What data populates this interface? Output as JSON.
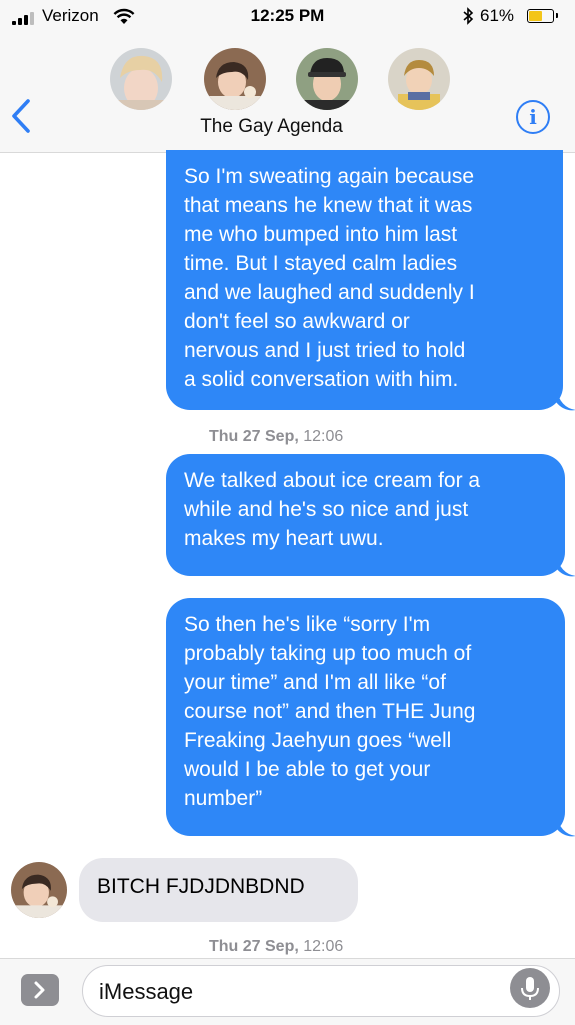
{
  "status_bar": {
    "carrier": "Verizon",
    "time": "12:25 PM",
    "battery_percent": "61%",
    "battery_level": 0.61
  },
  "header": {
    "group_name": "The Gay Agenda",
    "info_glyph": "i",
    "back_icon": "chevron-left-icon"
  },
  "messages": [
    {
      "direction": "outgoing",
      "text": "So I'm sweating again because\nthat means he knew that it was\nme who bumped into him last\ntime. But I stayed calm ladies\nand  we laughed and suddenly I\ndon't feel so awkward or\nnervous and I just tried to hold\na solid conversation with him."
    },
    {
      "direction": "outgoing",
      "text": "We talked about ice cream for a\nwhile and he's so nice and just\nmakes my heart uwu."
    },
    {
      "direction": "outgoing",
      "text": "So then he's like “sorry I'm\nprobably taking up too much of\nyour time” and I'm all like “of\ncourse not” and then THE Jung\nFreaking Jaehyun goes “well\nwould I be able to get your\nnumber”"
    },
    {
      "direction": "incoming",
      "text": "BITCH FJDJDNBDND"
    }
  ],
  "timestamps": [
    {
      "day": "Thu 27 Sep,",
      "time": "12:06"
    },
    {
      "day": "Thu 27 Sep,",
      "time": "12:06"
    }
  ],
  "composer": {
    "placeholder": "iMessage"
  },
  "colors": {
    "outgoing_bubble": "#2e87f7",
    "incoming_bubble": "#e6e6eb",
    "accent": "#2f7ef5",
    "battery": "#f3c518"
  }
}
